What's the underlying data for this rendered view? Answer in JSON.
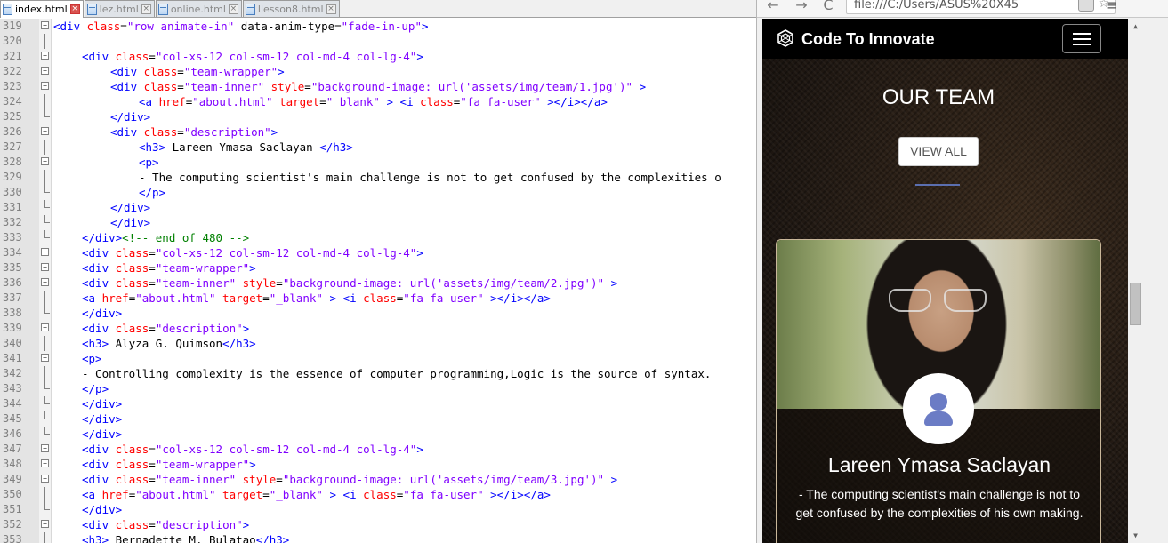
{
  "editor": {
    "tabs": [
      {
        "label": "index.html",
        "active": true
      },
      {
        "label": "lez.html",
        "active": false
      },
      {
        "label": "online.html",
        "active": false
      },
      {
        "label": "llesson8.html",
        "active": false
      }
    ],
    "lines": [
      {
        "n": "319",
        "fold": "minus",
        "indent": 0,
        "tokens": [
          [
            "tag",
            "<div "
          ],
          [
            "attr",
            "class"
          ],
          [
            "txt",
            "="
          ],
          [
            "val",
            "\"row animate-in\""
          ],
          [
            "txt",
            " data-anim-type="
          ],
          [
            "val",
            "\"fade-in-up\""
          ],
          [
            "tag",
            ">"
          ]
        ]
      },
      {
        "n": "320",
        "fold": "line",
        "indent": 0,
        "tokens": []
      },
      {
        "n": "321",
        "fold": "minus",
        "indent": 1,
        "tokens": [
          [
            "tag",
            "<div "
          ],
          [
            "attr",
            "class"
          ],
          [
            "txt",
            "="
          ],
          [
            "val",
            "\"col-xs-12 col-sm-12 col-md-4 col-lg-4\""
          ],
          [
            "tag",
            ">"
          ]
        ]
      },
      {
        "n": "322",
        "fold": "minus",
        "indent": 2,
        "tokens": [
          [
            "tag",
            "<div "
          ],
          [
            "attr",
            "class"
          ],
          [
            "txt",
            "="
          ],
          [
            "val",
            "\"team-wrapper\""
          ],
          [
            "tag",
            ">"
          ]
        ]
      },
      {
        "n": "323",
        "fold": "minus",
        "indent": 2,
        "tokens": [
          [
            "tag",
            "<div "
          ],
          [
            "attr",
            "class"
          ],
          [
            "txt",
            "="
          ],
          [
            "val",
            "\"team-inner\""
          ],
          [
            "attr",
            " style"
          ],
          [
            "txt",
            "="
          ],
          [
            "val",
            "\"background-image: url('assets/img/team/1.jpg')\""
          ],
          [
            "tag",
            " >"
          ]
        ]
      },
      {
        "n": "324",
        "fold": "line",
        "indent": 3,
        "tokens": [
          [
            "tag",
            "<a "
          ],
          [
            "attr",
            "href"
          ],
          [
            "txt",
            "="
          ],
          [
            "val",
            "\"about.html\""
          ],
          [
            "attr",
            " target"
          ],
          [
            "txt",
            "="
          ],
          [
            "val",
            "\"_blank\""
          ],
          [
            "tag",
            " > <i "
          ],
          [
            "attr",
            "class"
          ],
          [
            "txt",
            "="
          ],
          [
            "val",
            "\"fa fa-user\""
          ],
          [
            "tag",
            " ></i></a>"
          ]
        ]
      },
      {
        "n": "325",
        "fold": "end",
        "indent": 2,
        "tokens": [
          [
            "tag",
            "</div>"
          ]
        ]
      },
      {
        "n": "326",
        "fold": "minus",
        "indent": 2,
        "tokens": [
          [
            "tag",
            "<div "
          ],
          [
            "attr",
            "class"
          ],
          [
            "txt",
            "="
          ],
          [
            "val",
            "\"description\""
          ],
          [
            "tag",
            ">"
          ]
        ]
      },
      {
        "n": "327",
        "fold": "line",
        "indent": 3,
        "tokens": [
          [
            "tag",
            "<h3>"
          ],
          [
            "txt",
            " Lareen Ymasa Saclayan "
          ],
          [
            "tag",
            "</h3>"
          ]
        ]
      },
      {
        "n": "328",
        "fold": "minus",
        "indent": 3,
        "tokens": [
          [
            "tag",
            "<p>"
          ]
        ]
      },
      {
        "n": "329",
        "fold": "line",
        "indent": 3,
        "tokens": [
          [
            "txt",
            "- The computing scientist's main challenge is not to get confused by the complexities o"
          ]
        ]
      },
      {
        "n": "330",
        "fold": "end",
        "indent": 3,
        "tokens": [
          [
            "tag",
            "</p>"
          ]
        ]
      },
      {
        "n": "331",
        "fold": "end",
        "indent": 2,
        "tokens": [
          [
            "tag",
            "</div>"
          ]
        ]
      },
      {
        "n": "332",
        "fold": "end",
        "indent": 2,
        "tokens": [
          [
            "tag",
            "</div>"
          ]
        ]
      },
      {
        "n": "333",
        "fold": "end",
        "indent": 1,
        "tokens": [
          [
            "tag",
            "</div>"
          ],
          [
            "cmt",
            "<!-- end of 480 -->"
          ]
        ]
      },
      {
        "n": "334",
        "fold": "minus",
        "indent": 1,
        "tokens": [
          [
            "tag",
            "<div "
          ],
          [
            "attr",
            "class"
          ],
          [
            "txt",
            "="
          ],
          [
            "val",
            "\"col-xs-12 col-sm-12 col-md-4 col-lg-4\""
          ],
          [
            "tag",
            ">"
          ]
        ]
      },
      {
        "n": "335",
        "fold": "minus",
        "indent": 1,
        "tokens": [
          [
            "tag",
            "<div "
          ],
          [
            "attr",
            "class"
          ],
          [
            "txt",
            "="
          ],
          [
            "val",
            "\"team-wrapper\""
          ],
          [
            "tag",
            ">"
          ]
        ]
      },
      {
        "n": "336",
        "fold": "minus",
        "indent": 1,
        "tokens": [
          [
            "tag",
            "<div "
          ],
          [
            "attr",
            "class"
          ],
          [
            "txt",
            "="
          ],
          [
            "val",
            "\"team-inner\""
          ],
          [
            "attr",
            " style"
          ],
          [
            "txt",
            "="
          ],
          [
            "val",
            "\"background-image: url('assets/img/team/2.jpg')\""
          ],
          [
            "tag",
            " >"
          ]
        ]
      },
      {
        "n": "337",
        "fold": "line",
        "indent": 1,
        "tokens": [
          [
            "tag",
            "<a "
          ],
          [
            "attr",
            "href"
          ],
          [
            "txt",
            "="
          ],
          [
            "val",
            "\"about.html\""
          ],
          [
            "attr",
            " target"
          ],
          [
            "txt",
            "="
          ],
          [
            "val",
            "\"_blank\""
          ],
          [
            "tag",
            " > <i "
          ],
          [
            "attr",
            "class"
          ],
          [
            "txt",
            "="
          ],
          [
            "val",
            "\"fa fa-user\""
          ],
          [
            "tag",
            " ></i></a>"
          ]
        ]
      },
      {
        "n": "338",
        "fold": "end",
        "indent": 1,
        "tokens": [
          [
            "tag",
            "</div>"
          ]
        ]
      },
      {
        "n": "339",
        "fold": "minus",
        "indent": 1,
        "tokens": [
          [
            "tag",
            "<div "
          ],
          [
            "attr",
            "class"
          ],
          [
            "txt",
            "="
          ],
          [
            "val",
            "\"description\""
          ],
          [
            "tag",
            ">"
          ]
        ]
      },
      {
        "n": "340",
        "fold": "line",
        "indent": 1,
        "tokens": [
          [
            "tag",
            "<h3>"
          ],
          [
            "txt",
            " Alyza G. Quimson"
          ],
          [
            "tag",
            "</h3>"
          ]
        ]
      },
      {
        "n": "341",
        "fold": "minus",
        "indent": 1,
        "tokens": [
          [
            "tag",
            "<p>"
          ]
        ]
      },
      {
        "n": "342",
        "fold": "line",
        "indent": 1,
        "tokens": [
          [
            "txt",
            "- Controlling complexity is the essence of computer programming,Logic is the source of syntax."
          ]
        ]
      },
      {
        "n": "343",
        "fold": "end",
        "indent": 1,
        "tokens": [
          [
            "tag",
            "</p>"
          ]
        ]
      },
      {
        "n": "344",
        "fold": "end",
        "indent": 1,
        "tokens": [
          [
            "tag",
            "</div>"
          ]
        ]
      },
      {
        "n": "345",
        "fold": "end",
        "indent": 1,
        "tokens": [
          [
            "tag",
            "</div>"
          ]
        ]
      },
      {
        "n": "346",
        "fold": "end",
        "indent": 1,
        "tokens": [
          [
            "tag",
            "</div>"
          ]
        ]
      },
      {
        "n": "347",
        "fold": "minus",
        "indent": 1,
        "tokens": [
          [
            "tag",
            "<div "
          ],
          [
            "attr",
            "class"
          ],
          [
            "txt",
            "="
          ],
          [
            "val",
            "\"col-xs-12 col-sm-12 col-md-4 col-lg-4\""
          ],
          [
            "tag",
            ">"
          ]
        ]
      },
      {
        "n": "348",
        "fold": "minus",
        "indent": 1,
        "tokens": [
          [
            "tag",
            "<div "
          ],
          [
            "attr",
            "class"
          ],
          [
            "txt",
            "="
          ],
          [
            "val",
            "\"team-wrapper\""
          ],
          [
            "tag",
            ">"
          ]
        ]
      },
      {
        "n": "349",
        "fold": "minus",
        "indent": 1,
        "tokens": [
          [
            "tag",
            "<div "
          ],
          [
            "attr",
            "class"
          ],
          [
            "txt",
            "="
          ],
          [
            "val",
            "\"team-inner\""
          ],
          [
            "attr",
            " style"
          ],
          [
            "txt",
            "="
          ],
          [
            "val",
            "\"background-image: url('assets/img/team/3.jpg')\""
          ],
          [
            "tag",
            " >"
          ]
        ]
      },
      {
        "n": "350",
        "fold": "line",
        "indent": 1,
        "tokens": [
          [
            "tag",
            "<a "
          ],
          [
            "attr",
            "href"
          ],
          [
            "txt",
            "="
          ],
          [
            "val",
            "\"about.html\""
          ],
          [
            "attr",
            " target"
          ],
          [
            "txt",
            "="
          ],
          [
            "val",
            "\"_blank\""
          ],
          [
            "tag",
            " > <i "
          ],
          [
            "attr",
            "class"
          ],
          [
            "txt",
            "="
          ],
          [
            "val",
            "\"fa fa-user\""
          ],
          [
            "tag",
            " ></i></a>"
          ]
        ]
      },
      {
        "n": "351",
        "fold": "end",
        "indent": 1,
        "tokens": [
          [
            "tag",
            "</div>"
          ]
        ]
      },
      {
        "n": "352",
        "fold": "minus",
        "indent": 1,
        "tokens": [
          [
            "tag",
            "<div "
          ],
          [
            "attr",
            "class"
          ],
          [
            "txt",
            "="
          ],
          [
            "val",
            "\"description\""
          ],
          [
            "tag",
            ">"
          ]
        ]
      },
      {
        "n": "353",
        "fold": "line",
        "indent": 1,
        "tokens": [
          [
            "tag",
            "<h3>"
          ],
          [
            "txt",
            " Bernadette M. Bulatao"
          ],
          [
            "tag",
            "</h3>"
          ]
        ]
      }
    ]
  },
  "browser": {
    "back_label": "←",
    "forward_label": "→",
    "reload_label": "C",
    "url": "file:///C:/Users/ASUS%20X45",
    "star_label": "☆",
    "menu_label": "≡",
    "site": {
      "brand": "Code To Innovate",
      "section_title": "OUR TEAM",
      "view_all": "VIEW ALL",
      "member": {
        "name": "Lareen Ymasa Saclayan",
        "description": "- The computing scientist's main challenge is not to get confused by the complexities of his own making."
      }
    }
  },
  "colors": {
    "tag": "#0000ff",
    "attribute": "#ff0000",
    "value": "#8000ff",
    "comment": "#008000",
    "accent": "#5b6fb0"
  }
}
